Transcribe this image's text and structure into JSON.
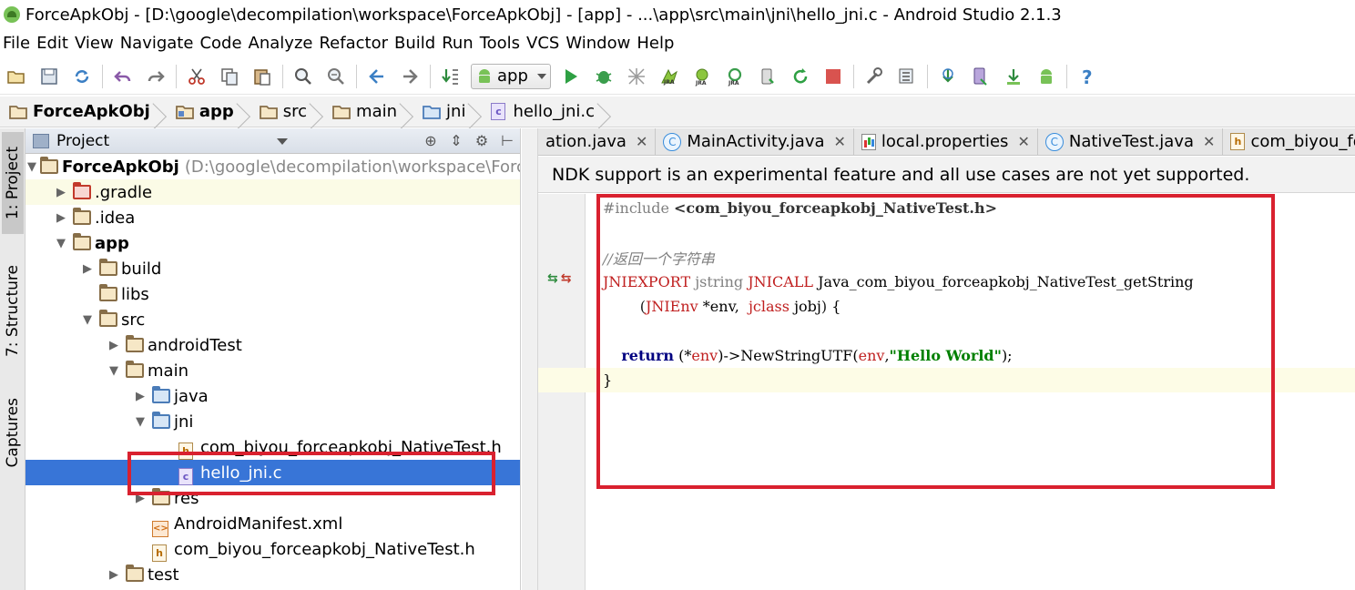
{
  "window": {
    "title": "ForceApkObj - [D:\\google\\decompilation\\workspace\\ForceApkObj] - [app] - ...\\app\\src\\main\\jni\\hello_jni.c - Android Studio 2.1.3"
  },
  "menu": {
    "items": [
      "File",
      "Edit",
      "View",
      "Navigate",
      "Code",
      "Analyze",
      "Refactor",
      "Build",
      "Run",
      "Tools",
      "VCS",
      "Window",
      "Help"
    ]
  },
  "toolbar": {
    "run_config": "app"
  },
  "breadcrumb": {
    "items": [
      "ForceApkObj",
      "app",
      "src",
      "main",
      "jni",
      "hello_jni.c"
    ]
  },
  "left_strip": {
    "project_tab": "1: Project",
    "structure_tab": "7: Structure",
    "captures_tab": "Captures"
  },
  "project_panel": {
    "title": "Project",
    "tree": [
      {
        "label": "ForceApkObj",
        "path": "(D:\\google\\decompilation\\workspace\\Force"
      },
      {
        "label": ".gradle"
      },
      {
        "label": ".idea"
      },
      {
        "label": "app"
      },
      {
        "label": "build"
      },
      {
        "label": "libs"
      },
      {
        "label": "src"
      },
      {
        "label": "androidTest"
      },
      {
        "label": "main"
      },
      {
        "label": "java"
      },
      {
        "label": "jni"
      },
      {
        "label": "com_biyou_forceapkobj_NativeTest.h"
      },
      {
        "label": "hello_jni.c"
      },
      {
        "label": "res"
      },
      {
        "label": "AndroidManifest.xml"
      },
      {
        "label": "com_biyou_forceapkobj_NativeTest.h"
      },
      {
        "label": "test"
      }
    ],
    "highlight_color": "#d9212f"
  },
  "editor_tabs": [
    {
      "label": "ation.java",
      "icon": "none"
    },
    {
      "label": "MainActivity.java",
      "icon": "class-icon"
    },
    {
      "label": "local.properties",
      "icon": "properties-icon"
    },
    {
      "label": "NativeTest.java",
      "icon": "class-icon"
    },
    {
      "label": "com_biyou_force",
      "icon": "header-file-icon"
    }
  ],
  "notice": {
    "text": "NDK support is an experimental feature and all use cases are not yet supported."
  },
  "code": {
    "line1_directive": "#include",
    "line1_header": "<com_biyou_forceapkobj_NativeTest.h>",
    "line3_comment": "//返回一个字符串",
    "line4_macro1": "JNIEXPORT",
    "line4_type": "jstring",
    "line4_macro2": "JNICALL",
    "line4_func": "Java_com_biyou_forceapkobj_NativeTest_getString",
    "line5_open": "(",
    "line5_type1": "JNIEnv",
    "line5_arg1": "*env,",
    "line5_type2": "jclass",
    "line5_arg2": "jobj",
    "line5_close": ")",
    "line5_brace": "{",
    "line7_kw": "return",
    "line7_expr1": "(*",
    "line7_env": "env",
    "line7_expr2": ")->NewStringUTF(",
    "line7_env2": "env",
    "line7_comma": ",",
    "line7_str": "\"Hello World\"",
    "line7_end": ");",
    "line8_close": "}"
  }
}
